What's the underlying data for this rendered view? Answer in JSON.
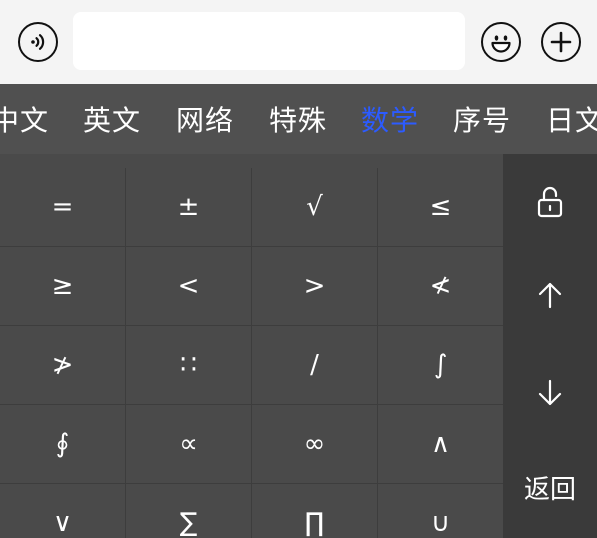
{
  "input_bar": {
    "voice_icon": "voice-icon",
    "emoji_icon": "emoji-icon",
    "plus_icon": "plus-icon",
    "text_value": ""
  },
  "tabs": [
    {
      "label": "中文",
      "active": false
    },
    {
      "label": "英文",
      "active": false
    },
    {
      "label": "网络",
      "active": false
    },
    {
      "label": "特殊",
      "active": false
    },
    {
      "label": "数学",
      "active": true
    },
    {
      "label": "序号",
      "active": false
    },
    {
      "label": "日文",
      "active": false
    }
  ],
  "symbols": [
    [
      "=",
      "±",
      "√",
      "≤"
    ],
    [
      "≥",
      "<",
      ">",
      "≮"
    ],
    [
      "≯",
      "∷",
      "/",
      "∫"
    ],
    [
      "∮",
      "∝",
      "∞",
      "∧"
    ],
    [
      "∨",
      "∑",
      "∏",
      "∪"
    ]
  ],
  "side": {
    "lock_icon": "unlock-icon",
    "up_icon": "arrow-up-icon",
    "down_icon": "arrow-down-icon",
    "back_label": "返回"
  },
  "colors": {
    "active_tab": "#2c5bff",
    "keyboard_bg": "#4a4a4a",
    "side_bg": "#3a3a3a",
    "input_bar_bg": "#f4f4f4"
  }
}
